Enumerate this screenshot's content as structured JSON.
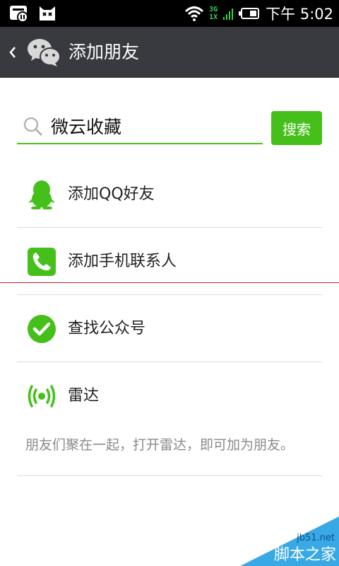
{
  "status_bar": {
    "net_top": "3G",
    "net_bottom": "1X",
    "time": "下午 5:02",
    "icons": [
      "notification-app-icon",
      "cat-app-icon",
      "wifi-icon",
      "signal-icon",
      "battery-icon"
    ]
  },
  "header": {
    "title": "添加朋友",
    "back_icon": "chevron-left-icon",
    "logo_icon": "wechat-logo-icon"
  },
  "search": {
    "value": "微云收藏",
    "placeholder": "",
    "button_label": "搜索"
  },
  "list": {
    "items": [
      {
        "label": "添加QQ好友",
        "icon": "qq-penguin-icon"
      },
      {
        "label": "添加手机联系人",
        "icon": "phone-icon"
      },
      {
        "label": "查找公众号",
        "icon": "check-circle-icon"
      },
      {
        "label": "雷达",
        "icon": "radar-icon"
      }
    ],
    "hint": "朋友们聚在一起，打开雷达，即可加为朋友。"
  },
  "watermark": {
    "site": "jb51.net",
    "name": "脚本之家"
  },
  "colors": {
    "accent": "#45c01a",
    "title_bar": "#393a3f",
    "status_bar": "#000000",
    "hint_text": "#8a8a8a"
  }
}
